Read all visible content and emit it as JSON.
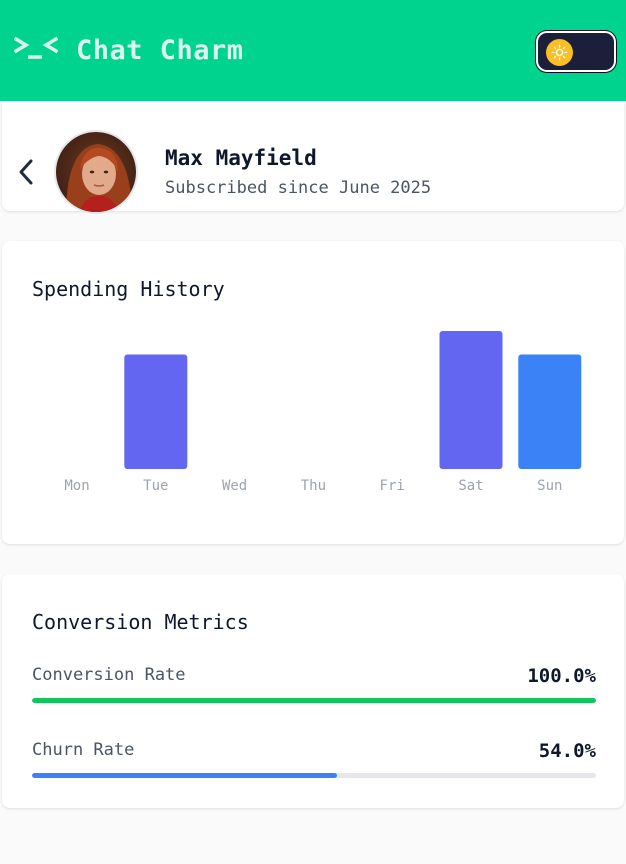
{
  "header": {
    "app_title": "Chat Charm",
    "brand_icon": "terminal-icon",
    "theme_toggle_icon": "sun-icon",
    "accent": "#00d38e"
  },
  "profile": {
    "name": "Max Mayfield",
    "subtitle": "Subscribed since June 2025",
    "back_icon": "chevron-left-icon"
  },
  "spending": {
    "title": "Spending History"
  },
  "chart_data": {
    "type": "bar",
    "categories": [
      "Mon",
      "Tue",
      "Wed",
      "Thu",
      "Fri",
      "Sat",
      "Sun"
    ],
    "values": [
      0,
      83,
      0,
      0,
      0,
      100,
      83
    ],
    "colors": [
      "#6366f1",
      "#6366f1",
      "#6366f1",
      "#6366f1",
      "#6366f1",
      "#6366f1",
      "#3b82f6"
    ],
    "ylim": [
      0,
      100
    ],
    "grid": false
  },
  "metrics": {
    "title": "Conversion Metrics",
    "items": [
      {
        "label": "Conversion Rate",
        "value": "100.0%",
        "fraction": 1.0,
        "color": "#10c55e"
      },
      {
        "label": "Churn Rate",
        "value": "54.0%",
        "fraction": 0.54,
        "color": "#3b82f6"
      }
    ]
  }
}
